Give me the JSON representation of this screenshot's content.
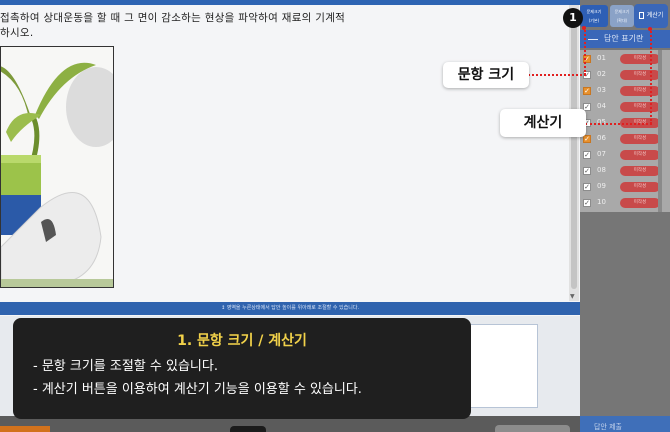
{
  "question": {
    "line1": "접촉하여 상대운동을 할 때 그 면이 감소하는 현상을 파악하여 재료의 기계적",
    "line2": "하시오."
  },
  "resize_hint": "↕ 영역을 누른상태에서 답안 높이를 위아래로 조절할 수 있습니다.",
  "toolbar": {
    "textsize_label_a": "문제크기",
    "textsize_label_b": "(기본)",
    "textsize2_label_a": "문제크기",
    "textsize2_label_b": "(확대)",
    "calc_label": "계산기"
  },
  "answer_panel": {
    "title": "답안 표기란",
    "rows": [
      {
        "num": "01",
        "checked": true,
        "status": "미작성"
      },
      {
        "num": "02",
        "checked": false,
        "status": "미작성"
      },
      {
        "num": "03",
        "checked": true,
        "status": "미작성"
      },
      {
        "num": "04",
        "checked": false,
        "status": "미작성"
      },
      {
        "num": "05",
        "checked": false,
        "status": "미작성"
      },
      {
        "num": "06",
        "checked": true,
        "status": "미작성"
      },
      {
        "num": "07",
        "checked": false,
        "status": "미작성"
      },
      {
        "num": "08",
        "checked": false,
        "status": "미작성"
      },
      {
        "num": "09",
        "checked": false,
        "status": "미작성"
      },
      {
        "num": "10",
        "checked": false,
        "status": "미작성"
      }
    ]
  },
  "side_bottom_label": "답안 제출",
  "overlay": {
    "step_number": "1",
    "callout_textsize": "문항 크기",
    "callout_calc": "계산기",
    "tip": {
      "title": "1. 문항 크기 / 계산기",
      "lines": [
        "- 문항 크기를 조절할 수 있습니다.",
        "- 계산기 버튼을 이용하여 계산기 기능을 이용할 수 있습니다."
      ]
    }
  },
  "colors": {
    "accent_blue": "#2f63ae",
    "tip_title_yellow": "#f2d24a",
    "callout_line_red": "#e02020",
    "status_pill_red": "#c84a4a",
    "checkbox_orange": "#e7912e"
  }
}
